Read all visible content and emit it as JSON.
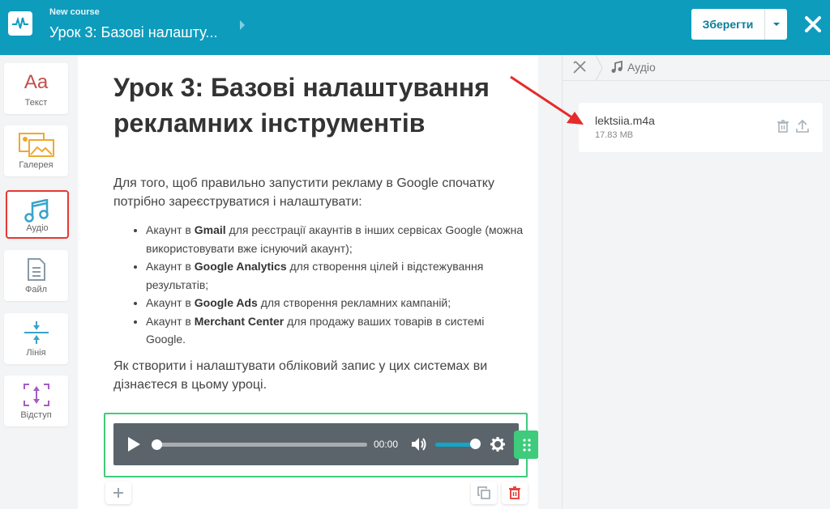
{
  "header": {
    "course_label": "New course",
    "lesson_title": "Урок 3: Базові налашту...",
    "save_label": "Зберегти",
    "brand_color": "#0e9cbd"
  },
  "tools": [
    {
      "label": "Текст",
      "icon": "text-aa-icon"
    },
    {
      "label": "Галерея",
      "icon": "gallery-icon"
    },
    {
      "label": "Аудіо",
      "icon": "music-note-icon",
      "active": true
    },
    {
      "label": "Файл",
      "icon": "file-icon"
    },
    {
      "label": "Лінія",
      "icon": "line-icon"
    },
    {
      "label": "Відступ",
      "icon": "spacing-icon"
    }
  ],
  "content": {
    "title": "Урок 3: Базові налаштування рекламних інструментів",
    "intro": "Для того, щоб правильно запустити рекламу в Google спочатку потрібно зареєструватися і налаштувати:",
    "bullets": [
      {
        "prefix": "Акаунт в ",
        "bold": "Gmail",
        "suffix": " для реєстрації акаунтів в інших сервісах Google (можна використовувати вже існуючий акаунт);"
      },
      {
        "prefix": "Акаунт в ",
        "bold": "Google Analytics",
        "suffix": " для створення цілей і відстежування результатів;"
      },
      {
        "prefix": "Акаунт в ",
        "bold": "Google Ads",
        "suffix": " для створення рекламних кампаній;"
      },
      {
        "prefix": "Акаунт в ",
        "bold": "Merchant Center",
        "suffix": " для продажу ваших товарів в системі Google."
      }
    ],
    "outro": "Як створити і налаштувати обліковий запис у цих системах ви дізнаєтеся в цьому уроці."
  },
  "player": {
    "time": "00:00",
    "progress": 0,
    "volume": 1.0,
    "accent_color": "#3fcb7c"
  },
  "panel": {
    "breadcrumb": "Аудіо",
    "file_name": "lektsiia.m4a",
    "file_size": "17.83 MB"
  }
}
